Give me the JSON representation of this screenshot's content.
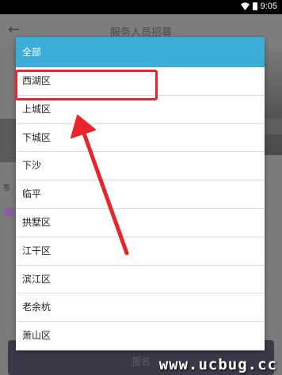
{
  "status_bar": {
    "time": "9:05"
  },
  "app": {
    "title": "服务人员招募",
    "side_label": "客",
    "bottom_button": "报名"
  },
  "dialog": {
    "header": "全部",
    "items": [
      "西湖区",
      "上城区",
      "下城区",
      "下沙",
      "临平",
      "拱墅区",
      "江干区",
      "滨江区",
      "老余杭",
      "萧山区"
    ]
  },
  "watermark": "www.ucbug.cc",
  "colors": {
    "header": "#3aaed8",
    "annotation": "#e8252a"
  }
}
